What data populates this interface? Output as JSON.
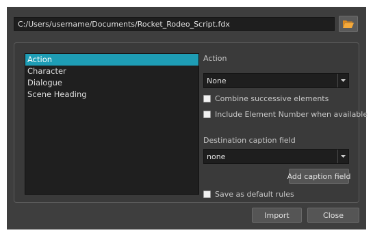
{
  "file": {
    "path": "C:/Users/username/Documents/Rocket_Rodeo_Script.fdx",
    "browse_icon": "folder-icon",
    "icon_color": "#f0a030"
  },
  "elements_list": {
    "items": [
      "Action",
      "Character",
      "Dialogue",
      "Scene Heading"
    ],
    "selected_index": 0,
    "selected_color": "#1e9db5"
  },
  "action": {
    "label": "Action",
    "value": "None"
  },
  "options": {
    "combine_label": "Combine successive elements",
    "combine_checked": false,
    "include_number_label": "Include Element Number when available",
    "include_number_checked": false
  },
  "destination": {
    "label": "Destination caption field",
    "value": "none",
    "add_button": "Add caption field"
  },
  "save_default": {
    "label": "Save as default rules",
    "checked": false
  },
  "footer": {
    "import_label": "Import",
    "close_label": "Close"
  }
}
